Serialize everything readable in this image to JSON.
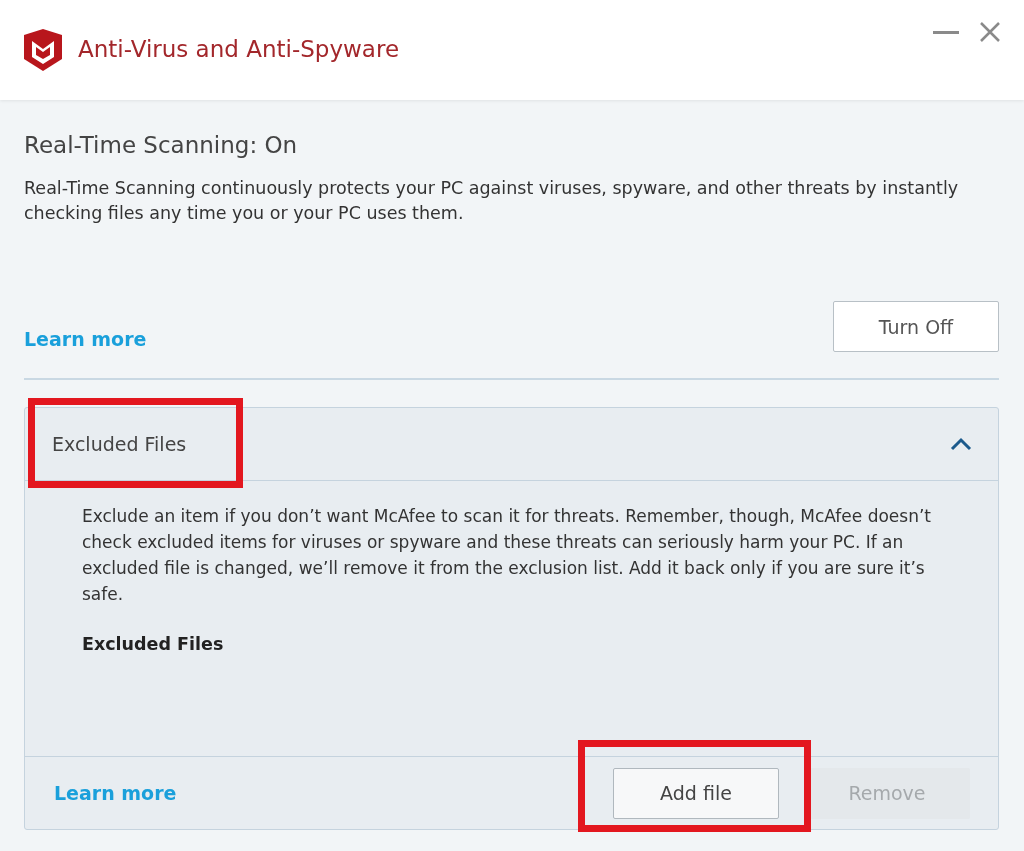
{
  "window": {
    "title": "Anti-Virus and Anti-Spyware"
  },
  "scanning": {
    "title": "Real-Time Scanning: On",
    "description": "Real-Time Scanning continuously protects your PC against viruses, spyware, and other threats by instantly checking files any time you or your PC uses them.",
    "learn_more": "Learn more",
    "button": "Turn Off"
  },
  "excluded_panel": {
    "title": "Excluded Files",
    "expanded": true,
    "highlighted": true,
    "description": "Exclude an item if you don’t want McAfee to scan it for threats. Remember, though, McAfee doesn’t check excluded items for viruses or spyware and these threats can seriously harm your PC. If an excluded file is changed, we’ll remove it from the exclusion list. Add it back only if you are sure it’s safe.",
    "list_heading": "Excluded Files",
    "learn_more": "Learn more",
    "buttons": [
      {
        "label": "Add file",
        "disabled": false,
        "highlighted": true
      },
      {
        "label": "Remove",
        "disabled": true,
        "highlighted": false
      }
    ]
  }
}
